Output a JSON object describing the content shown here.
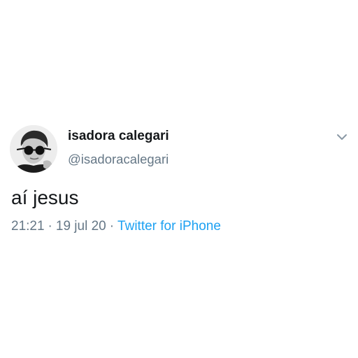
{
  "tweet": {
    "display_name": "isadora calegari",
    "handle": "@isadoracalegari",
    "text": "aí jesus",
    "time": "21:21",
    "date": "19 jul 20",
    "source": "Twitter for iPhone",
    "separator": "·"
  },
  "icons": {
    "avatar": "profile-photo",
    "menu": "chevron-down-icon"
  },
  "colors": {
    "text_primary": "#14171a",
    "text_secondary": "#657786",
    "link": "#1da1f2"
  }
}
